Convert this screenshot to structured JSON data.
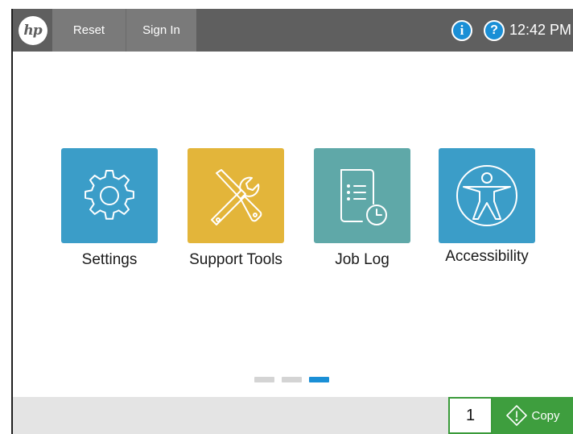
{
  "header": {
    "logo_text": "hp",
    "reset_label": "Reset",
    "signin_label": "Sign In",
    "info_glyph": "i",
    "help_glyph": "?",
    "time": "12:42 PM"
  },
  "apps": [
    {
      "label": "Settings",
      "icon": "gear-icon",
      "color": "#3b9dc8"
    },
    {
      "label": "Support Tools",
      "icon": "tools-icon",
      "color": "#e3b53a"
    },
    {
      "label": "Job Log",
      "icon": "job-log-icon",
      "color": "#5fa8a8"
    },
    {
      "label": "Accessibility",
      "icon": "accessibility-icon",
      "color": "#3b9dc8"
    }
  ],
  "pager": {
    "pages": 3,
    "current": 3
  },
  "footer": {
    "copies": "1",
    "copy_label": "Copy"
  },
  "colors": {
    "topbar": "#5f5f5f",
    "accent_blue": "#1a8fd6",
    "copy_green": "#3e9e3e"
  }
}
